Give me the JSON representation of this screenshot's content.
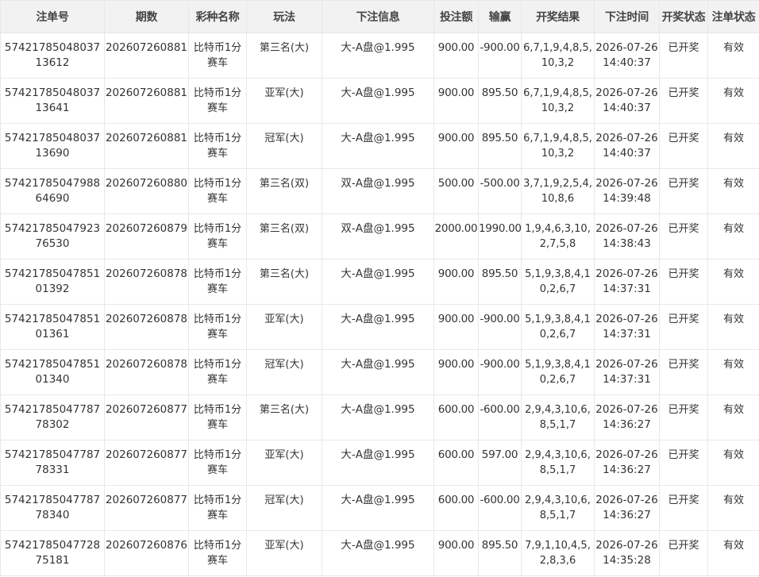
{
  "table": {
    "headers": [
      "注单号",
      "期数",
      "彩种名称",
      "玩法",
      "下注信息",
      "投注额",
      "输赢",
      "开奖结果",
      "下注时间",
      "开奖状态",
      "注单状态"
    ],
    "rows": [
      [
        "5742178504803713612",
        "202607260881",
        "比特币1分赛车",
        "第三名(大)",
        "大-A盘@1.995",
        "900.00",
        "-900.00",
        "6,7,1,9,4,8,5,10,3,2",
        "2026-07-26 14:40:37",
        "已开奖",
        "有效"
      ],
      [
        "5742178504803713641",
        "202607260881",
        "比特币1分赛车",
        "亚军(大)",
        "大-A盘@1.995",
        "900.00",
        "895.50",
        "6,7,1,9,4,8,5,10,3,2",
        "2026-07-26 14:40:37",
        "已开奖",
        "有效"
      ],
      [
        "5742178504803713690",
        "202607260881",
        "比特币1分赛车",
        "冠军(大)",
        "大-A盘@1.995",
        "900.00",
        "895.50",
        "6,7,1,9,4,8,5,10,3,2",
        "2026-07-26 14:40:37",
        "已开奖",
        "有效"
      ],
      [
        "5742178504798864690",
        "202607260880",
        "比特币1分赛车",
        "第三名(双)",
        "双-A盘@1.995",
        "500.00",
        "-500.00",
        "3,7,1,9,2,5,4,10,8,6",
        "2026-07-26 14:39:48",
        "已开奖",
        "有效"
      ],
      [
        "5742178504792376530",
        "202607260879",
        "比特币1分赛车",
        "第三名(双)",
        "双-A盘@1.995",
        "2000.00",
        "1990.00",
        "1,9,4,6,3,10,2,7,5,8",
        "2026-07-26 14:38:43",
        "已开奖",
        "有效"
      ],
      [
        "5742178504785101392",
        "202607260878",
        "比特币1分赛车",
        "第三名(大)",
        "大-A盘@1.995",
        "900.00",
        "895.50",
        "5,1,9,3,8,4,10,2,6,7",
        "2026-07-26 14:37:31",
        "已开奖",
        "有效"
      ],
      [
        "5742178504785101361",
        "202607260878",
        "比特币1分赛车",
        "亚军(大)",
        "大-A盘@1.995",
        "900.00",
        "-900.00",
        "5,1,9,3,8,4,10,2,6,7",
        "2026-07-26 14:37:31",
        "已开奖",
        "有效"
      ],
      [
        "5742178504785101340",
        "202607260878",
        "比特币1分赛车",
        "冠军(大)",
        "大-A盘@1.995",
        "900.00",
        "-900.00",
        "5,1,9,3,8,4,10,2,6,7",
        "2026-07-26 14:37:31",
        "已开奖",
        "有效"
      ],
      [
        "5742178504778778302",
        "202607260877",
        "比特币1分赛车",
        "第三名(大)",
        "大-A盘@1.995",
        "600.00",
        "-600.00",
        "2,9,4,3,10,6,8,5,1,7",
        "2026-07-26 14:36:27",
        "已开奖",
        "有效"
      ],
      [
        "5742178504778778331",
        "202607260877",
        "比特币1分赛车",
        "亚军(大)",
        "大-A盘@1.995",
        "600.00",
        "597.00",
        "2,9,4,3,10,6,8,5,1,7",
        "2026-07-26 14:36:27",
        "已开奖",
        "有效"
      ],
      [
        "5742178504778778340",
        "202607260877",
        "比特币1分赛车",
        "冠军(大)",
        "大-A盘@1.995",
        "600.00",
        "-600.00",
        "2,9,4,3,10,6,8,5,1,7",
        "2026-07-26 14:36:27",
        "已开奖",
        "有效"
      ],
      [
        "5742178504772875181",
        "202607260876",
        "比特币1分赛车",
        "亚军(大)",
        "大-A盘@1.995",
        "900.00",
        "895.50",
        "7,9,1,10,4,5,2,8,3,6",
        "2026-07-26 14:35:28",
        "已开奖",
        "有效"
      ]
    ]
  },
  "colors": {
    "header_bg": "#f2f2f2",
    "border": "#e8e8e8",
    "text": "#333333"
  }
}
